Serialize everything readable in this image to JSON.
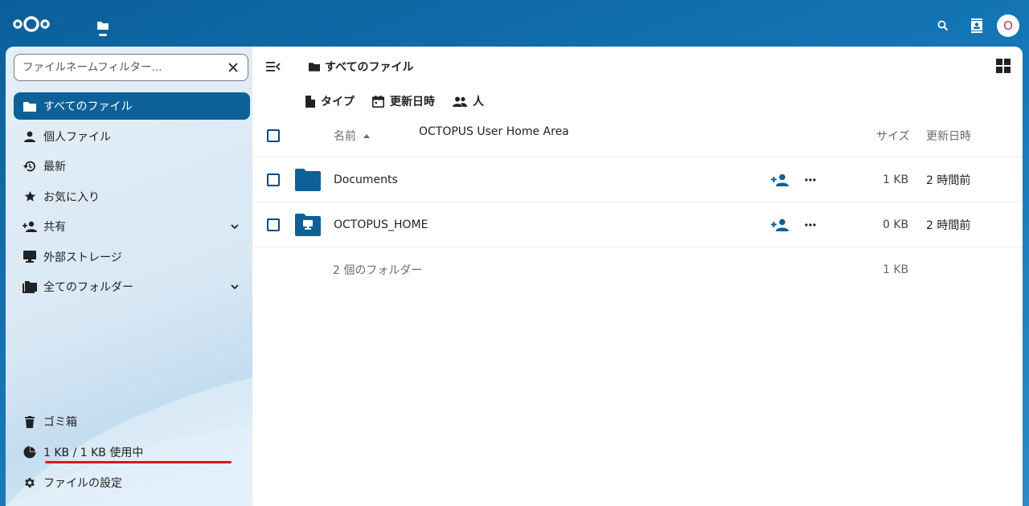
{
  "app": {
    "avatar_letter": "O",
    "brand_color": "#0d6198",
    "header_color": "#0b6aa3",
    "alert_color": "#e0141e"
  },
  "sidebar": {
    "filter_placeholder": "ファイルネームフィルター...",
    "items": [
      {
        "label": "すべてのファイル",
        "icon": "folder-icon",
        "active": true
      },
      {
        "label": "個人ファイル",
        "icon": "user-icon"
      },
      {
        "label": "最新",
        "icon": "history-icon"
      },
      {
        "label": "お気に入り",
        "icon": "star-icon"
      },
      {
        "label": "共有",
        "icon": "share-icon",
        "expandable": true
      },
      {
        "label": "外部ストレージ",
        "icon": "external-storage-icon"
      },
      {
        "label": "全てのフォルダー",
        "icon": "folder-multiple-icon",
        "expandable": true
      }
    ],
    "trash_label": "ゴミ箱",
    "quota_label": "1 KB / 1 KB 使用中",
    "settings_label": "ファイルの設定"
  },
  "main": {
    "breadcrumb": "すべてのファイル",
    "filters": {
      "type": "タイプ",
      "modified": "更新日時",
      "people": "人"
    },
    "header": {
      "name": "名前",
      "description": "OCTOPUS User Home Area",
      "size": "サイズ",
      "modified": "更新日時"
    },
    "rows": [
      {
        "name": "Documents",
        "size": "1 KB",
        "modified": "2 時間前",
        "icon": "folder-icon"
      },
      {
        "name": "OCTOPUS_HOME",
        "size": "0 KB",
        "modified": "2 時間前",
        "icon": "external-folder-icon"
      }
    ],
    "summary": {
      "text": "2 個のフォルダー",
      "size": "1 KB"
    }
  }
}
